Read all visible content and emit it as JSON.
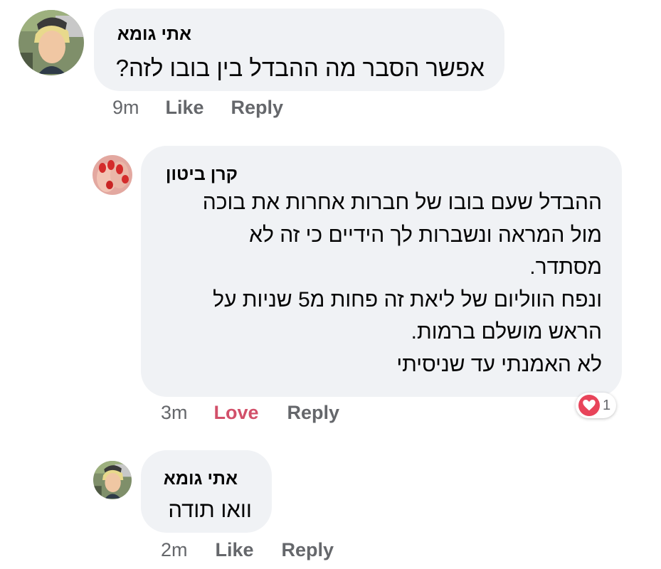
{
  "comments": [
    {
      "author": "אתי גומא",
      "text": "אפשר הסבר מה ההבדל בין בובו לזה?",
      "time": "9m",
      "like_label": "Like",
      "reply_label": "Reply"
    },
    {
      "author": "קרן ביטון",
      "text": "ההבדל שעם בובו של חברות אחרות את בוכה\nמול המראה ונשברות לך הידיים כי זה לא\nמסתדר.\nונפח הווליום של ליאת זה פחות מ5 שניות על\nהראש מושלם ברמות.\nלא האמנתי עד שניסיתי",
      "time": "3m",
      "like_label": "Love",
      "reply_label": "Reply",
      "reaction_count": "1",
      "reaction_icon": "heart-icon",
      "like_color": "#d2506a"
    },
    {
      "author": "אתי גומא",
      "text": "וואו תודה",
      "time": "2m",
      "like_label": "Like",
      "reply_label": "Reply"
    }
  ],
  "colors": {
    "bubble": "#f0f2f5",
    "meta_text": "#65676b",
    "love": "#d2506a",
    "reaction_heart": "#e8445a"
  }
}
